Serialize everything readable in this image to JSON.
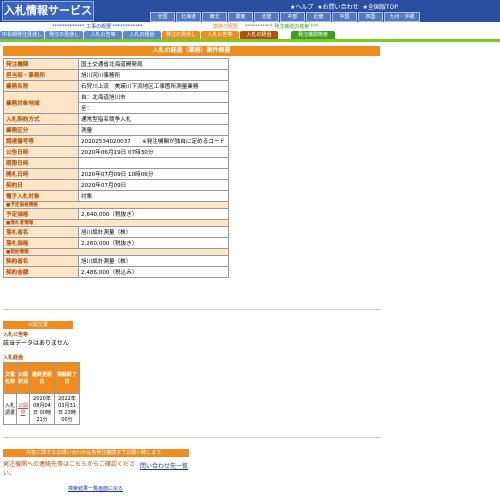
{
  "header": {
    "app_title": "入札情報サービス",
    "top_links": [
      "★ヘルプ",
      "★お問い合わせ",
      "★全国版TOP"
    ],
    "regions": [
      "全国",
      "北海道",
      "東北",
      "関東",
      "北陸",
      "中部",
      "近畿",
      "中国",
      "四国",
      "九州・沖縄"
    ]
  },
  "dot_rows": {
    "construction_overview": "************* 工事の概要 ************",
    "business_overview": "業務の概要",
    "orderer_search": "*********** 発注機関の検索 ***"
  },
  "nav": {
    "tabs": [
      "中長期発注見通し",
      "発注の見通し",
      "入札公告等",
      "入札の経過",
      "発注の見通し",
      "入札公告等",
      "入札の経過",
      "発注機関検索"
    ]
  },
  "page_title": "入札の経過（業務）案件概要",
  "details": [
    {
      "key": "発注機関",
      "value": "国土交通省北海道開発局"
    },
    {
      "key": "担当部・事務所",
      "value": "旭川河川事務所"
    },
    {
      "key": "業務名称",
      "value": "石狩川上流　美瑛川下流地区工事箇所測量業務"
    },
    {
      "key": "業務対象地域",
      "value": "自：北海道旭川市"
    },
    {
      "key": "",
      "value": "至："
    },
    {
      "key": "入札契約方式",
      "value": "通常型指名競争入札"
    },
    {
      "key": "業務区分",
      "value": "測量"
    },
    {
      "key": "調達番号等",
      "value": "20202534020037　　※発注機関が独自に定めるコード"
    },
    {
      "key": "公告日時",
      "value": "2020年06月19日 07時30分"
    },
    {
      "key": "期限日時",
      "value": ""
    },
    {
      "key": "開札日時",
      "value": "2020年07月09日 10時06分"
    },
    {
      "key": "契約日",
      "value": "2020年07月09日"
    },
    {
      "key": "電子入札対象",
      "value": "対象"
    }
  ],
  "section_estimate": "■予定価格情報",
  "estimate": {
    "key": "予定価格",
    "value": "2,640,000（税抜き）"
  },
  "section_award": "■落札者情報",
  "award": [
    {
      "key": "落札者名",
      "value": "旭川設計測量（株）"
    },
    {
      "key": "落札価格",
      "value": "2,260,000（税抜き）"
    }
  ],
  "section_contract": "■契約情報",
  "contract": [
    {
      "key": "契約者名",
      "value": "旭川設計測量（株）"
    },
    {
      "key": "契約金額",
      "value": "2,486,000（税込み）"
    }
  ],
  "public_docs": {
    "bar_label": "公開文書",
    "label_bid_notice": "入札公告等",
    "no_data": "該当データはありません",
    "label_progress": "入札経過",
    "headers": [
      "文書名称",
      "公開状況",
      "最終更新日",
      "掲載終了日"
    ],
    "rows": [
      {
        "name": "入札調書",
        "status": "公開中",
        "updated": "2020年08月04日 00時21分",
        "end": "2022年03月31日 23時00分"
      }
    ]
  },
  "footer": {
    "contact_bar": "内容に関するお問い合わせは各発注機関までお願い致します。",
    "contact_text": "発注機関への連絡先等はこちらからご確認ください。",
    "contact_link": "問い合わせ先一覧",
    "back_link": "検索結果一覧画面に戻る"
  }
}
